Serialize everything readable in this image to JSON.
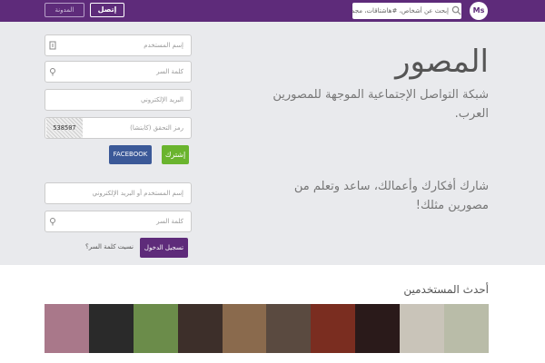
{
  "header": {
    "logo_text": "Ms",
    "search_placeholder": "إبحث عن أشخاص، #هاشتاقات، مجموعات",
    "connect_label": "إتصل",
    "blog_label": "المدونة"
  },
  "hero": {
    "title": "المصور",
    "subtitle": "شبكة التواصل الإجتماعية الموجهة للمصورين العرب.",
    "tagline": "شارك أفكارك وأعمالك، ساعد وتعلم من مصورين مثلك!"
  },
  "signup": {
    "username_placeholder": "إسم المستخدم",
    "password_placeholder": "كلمة السر",
    "email_placeholder": "البريد الإلكتروني",
    "captcha_placeholder": "رمز التحقق (كابتشا)",
    "captcha_text": "538507",
    "join_label": "إشترك",
    "facebook_label": "FACEBOOK"
  },
  "login": {
    "user_placeholder": "إسم المستخدم أو البريد الإلكتروني",
    "password_placeholder": "كلمة السر",
    "login_label": "تسجيل الدخول",
    "forgot_label": "نسيت كلمة السر؟"
  },
  "latest": {
    "title": "أحدث المستخدمين",
    "photos": [
      "#a9788a",
      "#2a2a2a",
      "#6b8c4a",
      "#3d2f2a",
      "#8a6a4d",
      "#5a4a40",
      "#7a2d20",
      "#2a1a1a",
      "#c9c4b9",
      "#b9bca8"
    ]
  },
  "colors": {
    "brand": "#5e2b7a",
    "join": "#6ab42e",
    "facebook": "#3b5998"
  }
}
